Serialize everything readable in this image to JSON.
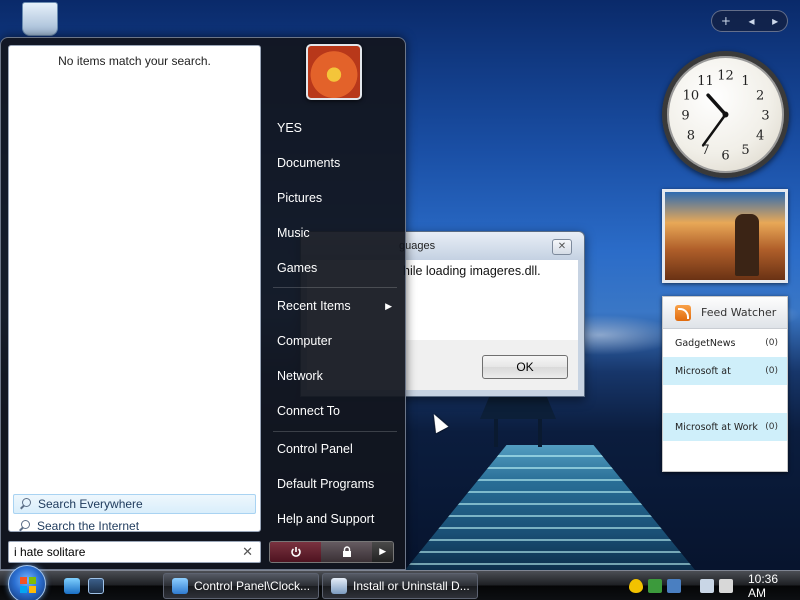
{
  "start_menu": {
    "no_results": "No items match your search.",
    "search_options": [
      {
        "label": "Search Everywhere"
      },
      {
        "label": "Search the Internet"
      }
    ],
    "search_query": "i hate solitare",
    "right_items": [
      {
        "label": "YES"
      },
      {
        "label": "Documents"
      },
      {
        "label": "Pictures"
      },
      {
        "label": "Music"
      },
      {
        "label": "Games"
      },
      {
        "label": "Recent Items",
        "has_submenu": true
      },
      {
        "label": "Computer"
      },
      {
        "label": "Network"
      },
      {
        "label": "Connect To"
      },
      {
        "label": "Control Panel"
      },
      {
        "label": "Default Programs"
      },
      {
        "label": "Help and Support"
      }
    ]
  },
  "dialog": {
    "title": "guages",
    "message": "hile loading imageres.dll.",
    "ok_label": "OK"
  },
  "clock_gadget": {
    "numerals": [
      "12",
      "1",
      "2",
      "3",
      "4",
      "5",
      "6",
      "7",
      "8",
      "9",
      "10",
      "11"
    ],
    "time": {
      "hour": 10,
      "minute": 36
    }
  },
  "feed_watcher": {
    "title": "Feed Watcher",
    "items": [
      {
        "name": "GadgetNews",
        "count": "(0)"
      },
      {
        "name": "Microsoft at",
        "count": "(0)"
      },
      {
        "name": "",
        "count": ""
      },
      {
        "name": "Microsoft at Work",
        "count": "(0)"
      },
      {
        "name": "",
        "count": ""
      }
    ]
  },
  "taskbar": {
    "buttons": [
      {
        "label": "Control Panel\\Clock..."
      },
      {
        "label": "Install or Uninstall D..."
      }
    ],
    "clock": "10:36 AM"
  },
  "colors": {
    "accent": "#2b6fd1",
    "feed_highlight": "#cfeffa"
  }
}
